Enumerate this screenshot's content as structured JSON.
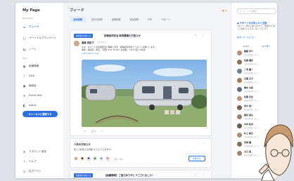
{
  "app": {
    "title": "My Page"
  },
  "sidebar": {
    "section_label": "Navigation",
    "items": [
      {
        "label": "フィード",
        "icon": "home-icon",
        "active": true
      },
      {
        "label": "パーソナルプライベート",
        "icon": "lock-icon"
      },
      {
        "label": "ノート",
        "icon": "note-icon"
      }
    ],
    "section2_label": "Plan",
    "items2": [
      {
        "label": "組織情報",
        "icon": "building-icon"
      },
      {
        "label": "Q&A",
        "icon": "question-icon"
      },
      {
        "label": "勉強会",
        "icon": "calendar-icon"
      },
      {
        "label": "Event Hub",
        "icon": "event-icon"
      },
      {
        "label": "works",
        "icon": "briefcase-icon"
      }
    ],
    "cta_label": "キャンセルに遷移する",
    "footer": [
      {
        "label": "アカウント設定",
        "icon": "gear-icon"
      },
      {
        "label": "ヘルプ",
        "icon": "help-icon"
      },
      {
        "label": "ログアウト",
        "icon": "logout-icon"
      }
    ]
  },
  "main": {
    "title": "フィード",
    "notification_count": "21",
    "tabs": [
      "全体投稿",
      "自分の投稿",
      "組織投稿",
      "部活投稿",
      "EXP",
      "サポート"
    ],
    "post1": {
      "badge": "投稿者のお知らせ",
      "title": "投稿者同志会 新規募集のお知らせ",
      "author": "堀越 美紀子",
      "handle": "@mikiko_h",
      "text_line1": "ネタ・ホワイトな家族集団で開催します。投稿者同志会でコメントお願いします。",
      "text_line2": "場所：時間帯 / 準定：「初回 3/11 10:00 / 交流費」 3/10 2名〜5名様",
      "link": "camnelium.co.jp",
      "reactions": [
        "♡ 3",
        "💬 2",
        "↗"
      ]
    },
    "post2": {
      "title": "人気のお知らせ",
      "question": "新しいお知らせが届いたらどうしますか？",
      "sub": "投票（6票）",
      "button": "投票する"
    },
    "post3": {
      "badge": "投稿者のお知らせ",
      "title": "【組織情報】ご協力ありがとうございました！"
    }
  },
  "right": {
    "search_placeholder": "フィードを検索",
    "support_title": "サポートのお知らせと支援",
    "support_body": "サポートに関する問い合わせとご支援をまとめてご案内いたします。詳しくはこちら",
    "support_link": "案内についてはこちら",
    "user_tabs": [
      "Public",
      "ユーザー"
    ],
    "users": [
      {
        "name": "藤藤 洋介",
        "sub": "自由を希望しました",
        "color": "#b78d6c"
      },
      {
        "name": "佐藤 優佳",
        "sub": "自由を希望しました",
        "color": "#8c6b5a"
      },
      {
        "name": "三宅 優一",
        "sub": "自由を希望しました",
        "color": "#6e7f9a"
      },
      {
        "name": "近藤 正平",
        "sub": "自由を希望しました",
        "color": "#a47b5f"
      },
      {
        "name": "橋本 太郎",
        "sub": "自由を希望しました",
        "color": "#5f6d7f"
      },
      {
        "name": "佐藤 百合",
        "sub": "自由を希望しました",
        "color": "#c29a7a"
      },
      {
        "name": "田中 真一",
        "sub": "自由を希望しました",
        "color": "#7a5f4f"
      },
      {
        "name": "藤田 亜矢",
        "sub": "自由を希望しました",
        "color": "#9b7e6a"
      },
      {
        "name": "木村 拓也",
        "sub": "自由を希望しました",
        "color": "#6b5a4c"
      },
      {
        "name": "村上 結衣",
        "sub": "自由を希望しました",
        "color": "#b48a70"
      },
      {
        "name": "宮地 優",
        "sub": "自由を希望しました",
        "color": "#85705f"
      },
      {
        "name": "山口 遥",
        "sub": "自由を希望しました",
        "color": "#a08670"
      }
    ]
  }
}
